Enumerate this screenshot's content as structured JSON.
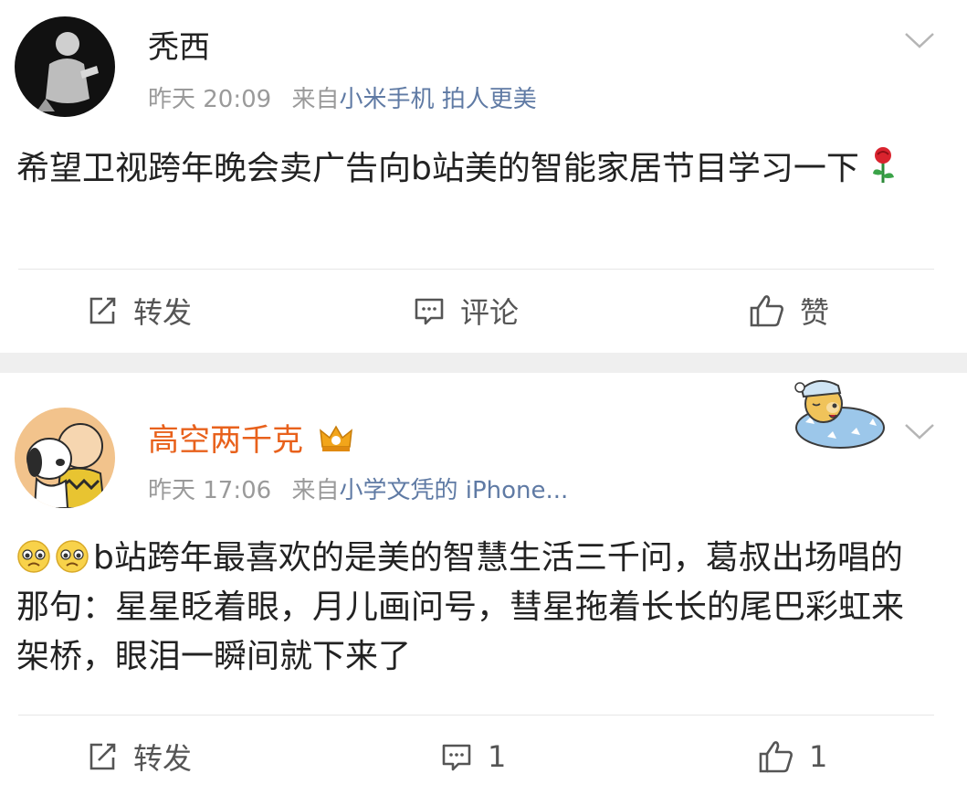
{
  "post1": {
    "username": "秃西",
    "time": "昨天 20:09",
    "from_label": "来自",
    "source": "小米手机 拍人更美",
    "content": "希望卫视跨年晚会卖广告向b站美的智能家居节目学习一下",
    "content_emoji": "rose-emoji",
    "actions": {
      "repost": "转发",
      "comment": "评论",
      "like": "赞"
    }
  },
  "post2": {
    "username": "高空两千克",
    "badge": "crown-icon",
    "time": "昨天 17:06",
    "from_label": "来自",
    "source": "小学文凭的 iPhone...",
    "content": "b站跨年最喜欢的是美的智慧生活三千问，葛叔出场唱的那句：星星眨着眼，月儿画问号，彗星拖着长长的尾巴彩虹来架桥，眼泪一瞬间就下来了",
    "content_emoji": [
      "teary-face-emoji",
      "teary-face-emoji"
    ],
    "sticker": "sleeping-bear-sticker",
    "actions": {
      "repost": "转发",
      "comment_count": "1",
      "like_count": "1"
    }
  },
  "colors": {
    "username_vip": "#e8611c",
    "source_link": "#5f7aa4",
    "meta_gray": "#9a9a9a",
    "separator": "#efefef"
  }
}
